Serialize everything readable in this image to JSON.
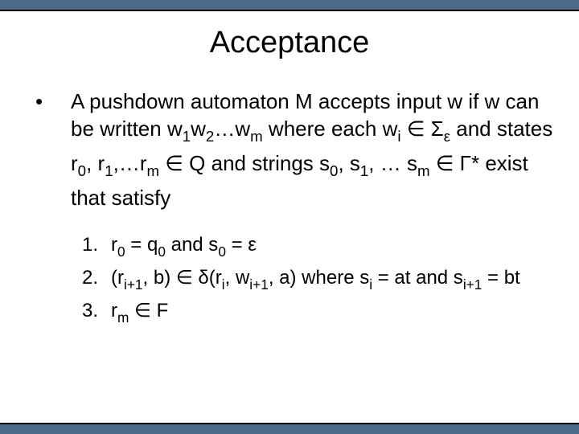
{
  "title": "Acceptance",
  "bullet": {
    "marker": "•",
    "parts": {
      "p0": "A pushdown automaton M accepts input w if w can be written w",
      "s1": "1",
      "p1": "w",
      "s2": "2",
      "p2": "…w",
      "sm": "m",
      "p3": " where each w",
      "si": "i",
      "p4": " ∈ Σ",
      "se": "ε",
      "p5": " and states r",
      "sr0": "0",
      "p6": ", r",
      "sr1": "1",
      "p7": ",…r",
      "srm": "m",
      "p8": " ∈ Q and strings s",
      "ss0": "0",
      "p9": ", s",
      "ss1": "1",
      "p10": ", … s",
      "ssm": "m",
      "p11": " ∈ Γ* exist that satisfy"
    }
  },
  "items": [
    {
      "marker": "1.",
      "parts": {
        "p0": "r",
        "s0": "0",
        "p1": " = q",
        "s1": "0",
        "p2": " and s",
        "s2": "0",
        "p3": " = ε"
      }
    },
    {
      "marker": "2.",
      "parts": {
        "p0": "(r",
        "s0": "i+1",
        "p1": ", b) ∈ δ(r",
        "s1": "i",
        "p2": ", w",
        "s2": "i+1",
        "p3": ", a) where s",
        "s3": "i",
        "p4": " = at and s",
        "s4": "i+1",
        "p5": " = bt"
      }
    },
    {
      "marker": "3.",
      "parts": {
        "p0": "r",
        "s0": "m",
        "p1": " ∈ F"
      }
    }
  ]
}
